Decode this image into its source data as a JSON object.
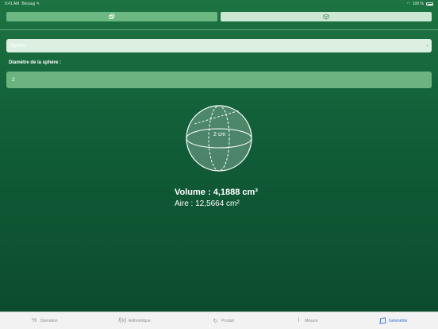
{
  "status_bar": {
    "time": "9:41 AM",
    "carrier": "Bécaug ✎",
    "battery": "100 %"
  },
  "segments": [
    {
      "icon": "square-stack-icon",
      "active": false
    },
    {
      "icon": "cube-icon",
      "active": true
    }
  ],
  "shape_select": {
    "value": "Sphère",
    "icon": "chevron-right-icon"
  },
  "diameter": {
    "label": "Diamètre de la sphère :",
    "value": "2"
  },
  "figure": {
    "dimension_label": "2 cm"
  },
  "results": {
    "volume": "Volume : 4,1888 cm³",
    "aire": "Aire : 12,5664 cm²"
  },
  "tab_bar": {
    "items": [
      {
        "label": "Opération",
        "icon": "percent-icon"
      },
      {
        "label": "Arithmétique",
        "icon": "function-icon"
      },
      {
        "label": "Produit",
        "icon": "refresh-icon"
      },
      {
        "label": "Mesure",
        "icon": "thermometer-icon"
      },
      {
        "label": "Géométrie",
        "icon": "polygon-icon",
        "active": true
      }
    ]
  },
  "colors": {
    "background_top": "#1d7442",
    "background_bottom": "#0b4a2c",
    "segment_active": "#cde8d2",
    "segment_inactive": "#6cb882",
    "input_fill": "#6bb480",
    "tab_active": "#2f6fd6"
  }
}
